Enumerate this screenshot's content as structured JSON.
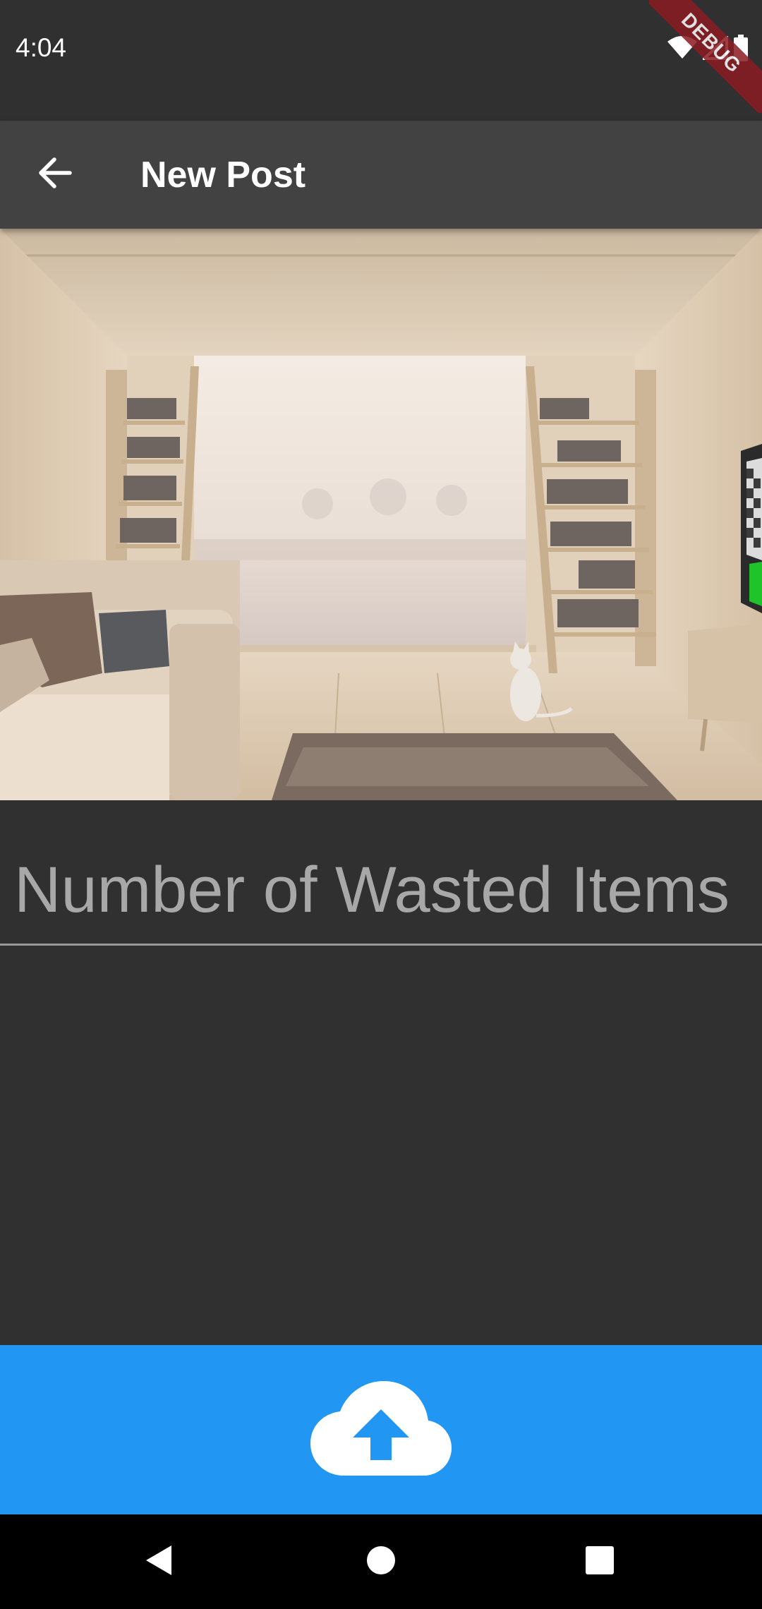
{
  "status_bar": {
    "time": "4:04",
    "icons": [
      "wifi-icon",
      "signal-icon",
      "battery-icon"
    ]
  },
  "debug_banner": {
    "label": "DEBUG"
  },
  "app_bar": {
    "back_icon": "arrow-back-icon",
    "title": "New Post"
  },
  "post_image": {
    "description_icon": "photo"
  },
  "wasted_items_field": {
    "placeholder": "Number of Wasted Items",
    "value": ""
  },
  "upload_button": {
    "icon": "cloud-upload-icon"
  },
  "nav_bar": {
    "icons": [
      "nav-back-icon",
      "nav-home-icon",
      "nav-recents-icon"
    ]
  },
  "colors": {
    "background": "#303030",
    "app_bar": "#424242",
    "accent": "#2196f3",
    "nav_bar": "#000000",
    "debug_banner": "#8a1b22"
  }
}
